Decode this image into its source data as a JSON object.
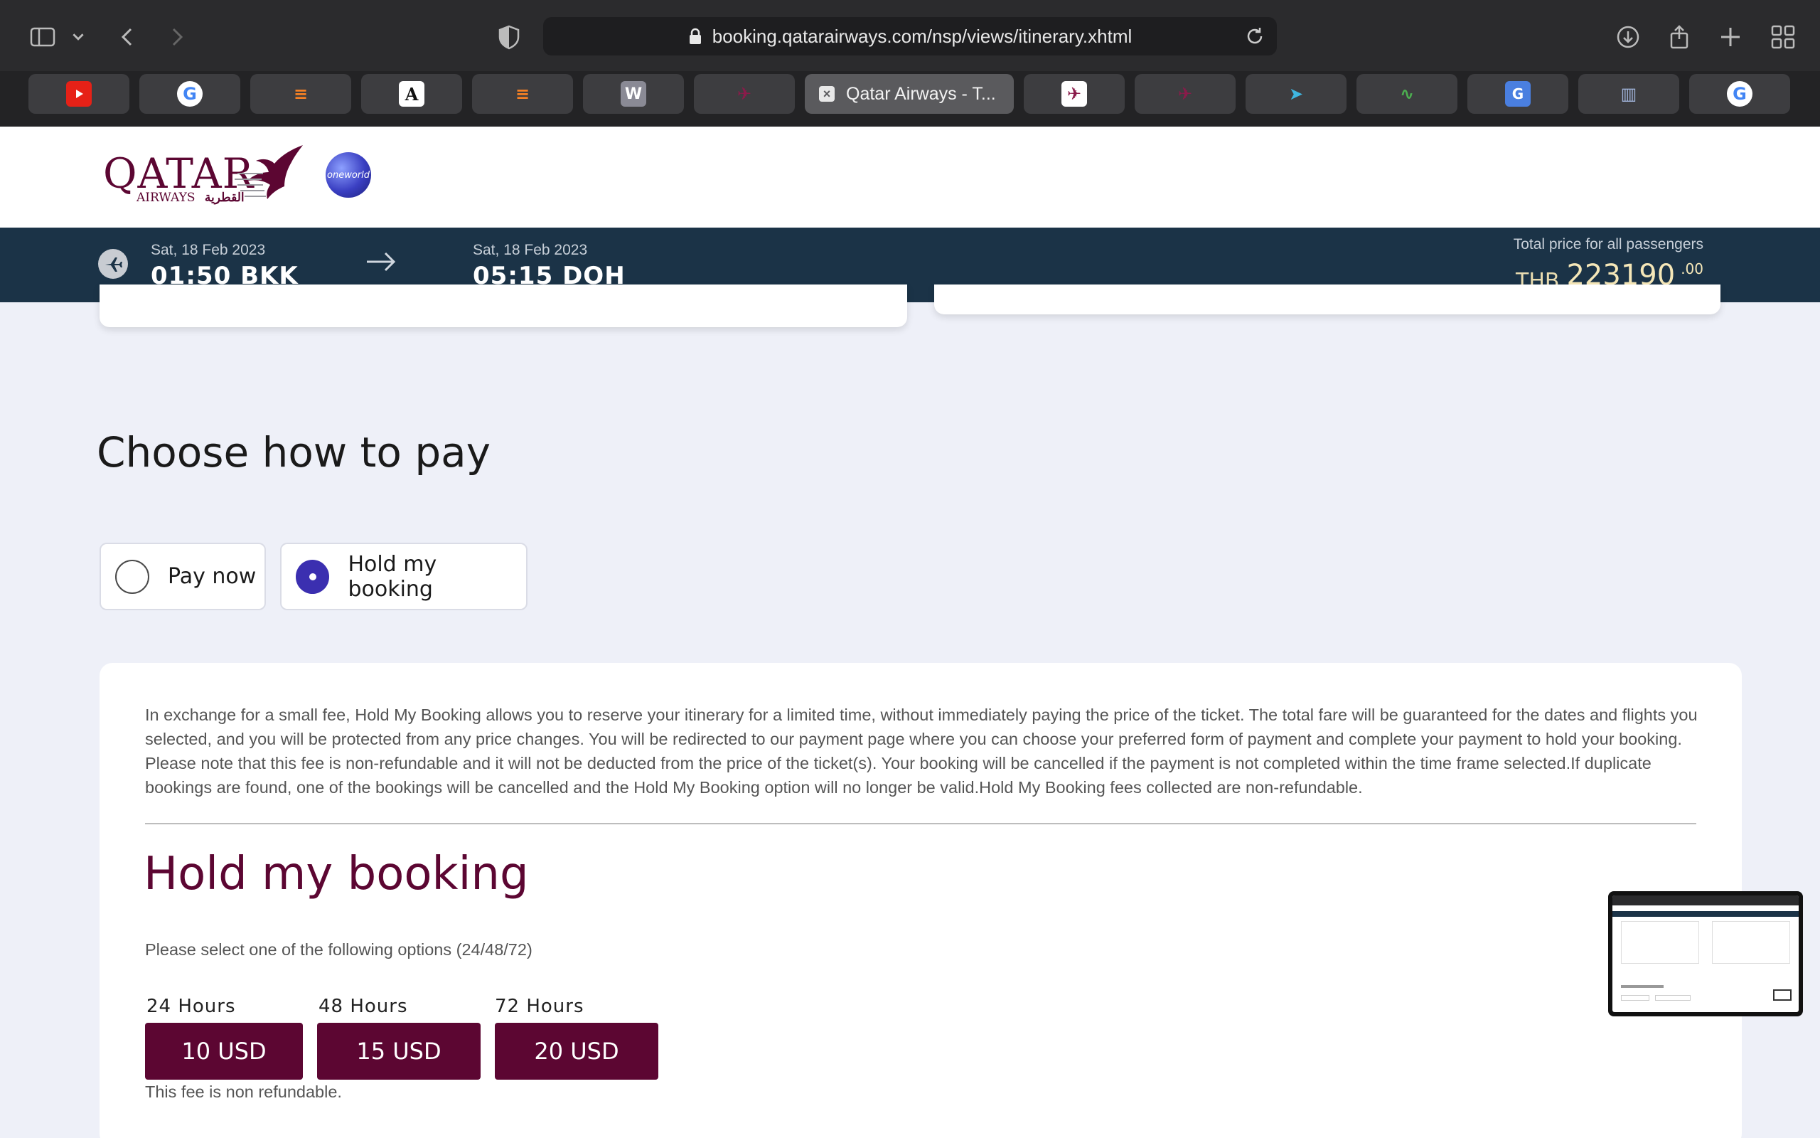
{
  "browser": {
    "url": "booking.qatarairways.com/nsp/views/itinerary.xhtml",
    "active_tab_title": "Qatar Airways - T...",
    "tab_icons": [
      "youtube-icon",
      "google-icon",
      "stackoverflow-icon",
      "dictionary-icon",
      "stackoverflow-icon",
      "w-icon",
      "qatar-icon",
      "qatar-icon",
      "qatar-icon",
      "bird-icon",
      "chart-icon",
      "translate-icon",
      "reader-icon",
      "google-icon"
    ]
  },
  "header": {
    "logo_text": "QATAR",
    "logo_sub": "AIRWAYS",
    "logo_arabic": "القطرية",
    "alliance": "oneworld"
  },
  "flight": {
    "departure": {
      "date": "Sat, 18 Feb 2023",
      "time_code": "01:50 BKK"
    },
    "arrival": {
      "date": "Sat, 18 Feb 2023",
      "time_code": "05:15 DOH"
    },
    "total_label": "Total price for all passengers",
    "currency": "THB",
    "amount": "223190",
    "decimals": ".00"
  },
  "payment": {
    "title": "Choose how to pay",
    "options": [
      {
        "label": "Pay now",
        "selected": false
      },
      {
        "label": "Hold my booking",
        "selected": true
      }
    ]
  },
  "hold": {
    "description": "In exchange for a small fee, Hold My Booking allows you to reserve your itinerary for a limited time, without immediately paying the price of the ticket. The total fare will be guaranteed for the dates and flights you selected, and you will be protected from any price changes. You will be redirected to our payment page where you can choose your preferred form of payment and complete your payment to hold your booking. Please note that this fee is non-refundable and it will not be deducted from the price of the ticket(s). Your booking will be cancelled if the payment is not completed within the time frame selected.If duplicate bookings are found, one of the bookings will be cancelled and the Hold My Booking option will no longer be valid.Hold My Booking fees collected are non-refundable.",
    "title": "Hold my booking",
    "instruction": "Please select one of the following options (24/48/72)",
    "options": [
      {
        "duration": "24 Hours",
        "price": "10 USD"
      },
      {
        "duration": "48 Hours",
        "price": "15 USD"
      },
      {
        "duration": "72 Hours",
        "price": "20 USD"
      }
    ],
    "fee_note": "This fee is non refundable."
  },
  "colors": {
    "brand": "#5c0632",
    "bar": "#1b3347",
    "radio_selected": "#3b2fb0"
  }
}
